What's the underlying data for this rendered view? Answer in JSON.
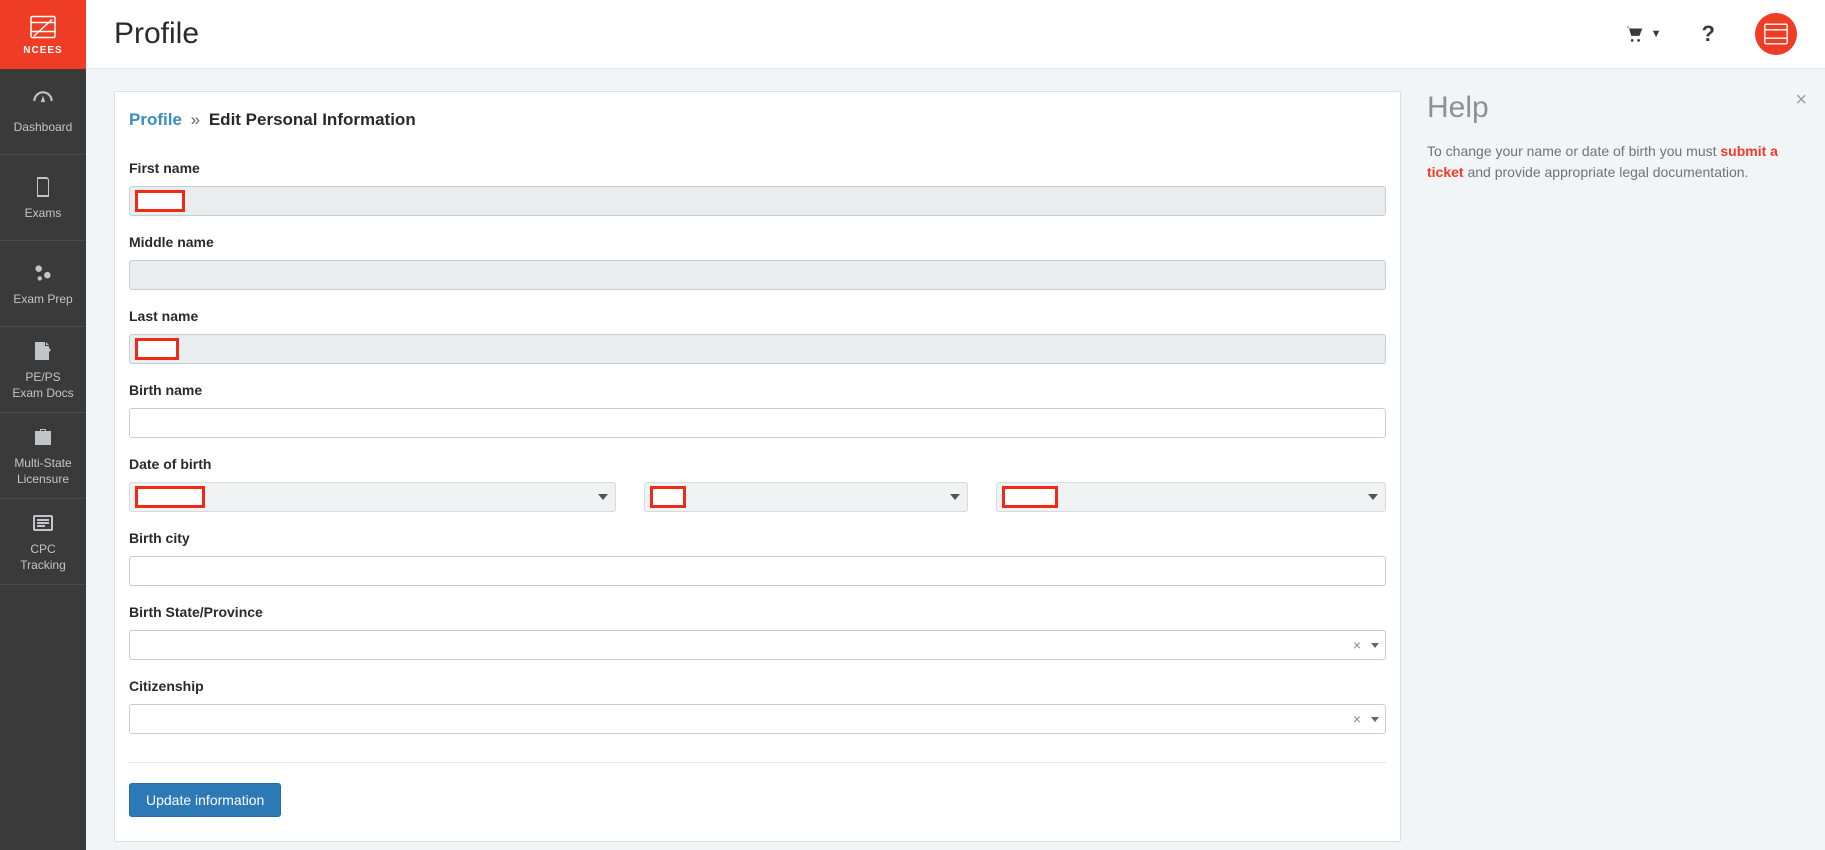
{
  "brand": {
    "text": "NCEES"
  },
  "header": {
    "title": "Profile"
  },
  "sidebar": {
    "items": [
      {
        "label": "Dashboard"
      },
      {
        "label": "Exams"
      },
      {
        "label": "Exam Prep"
      },
      {
        "label": "PE/PS\nExam Docs"
      },
      {
        "label": "Multi-State\nLicensure"
      },
      {
        "label": "CPC\nTracking"
      }
    ]
  },
  "breadcrumb": {
    "link": "Profile",
    "sep": "»",
    "current": "Edit Personal Information"
  },
  "form": {
    "labels": {
      "first_name": "First name",
      "middle_name": "Middle name",
      "last_name": "Last name",
      "birth_name": "Birth name",
      "dob": "Date of birth",
      "birth_city": "Birth city",
      "birth_state": "Birth State/Province",
      "citizenship": "Citizenship"
    },
    "values": {
      "first_name": "",
      "middle_name": "",
      "last_name": "",
      "birth_name": "",
      "dob_month": "",
      "dob_day": "",
      "dob_year": "",
      "birth_city": "",
      "birth_state": "",
      "citizenship": ""
    },
    "submit_label": "Update information"
  },
  "help": {
    "title": "Help",
    "pre_text": "To change your name or date of birth you must ",
    "link_text": "submit a ticket",
    "post_text": " and provide appropriate legal documentation."
  }
}
